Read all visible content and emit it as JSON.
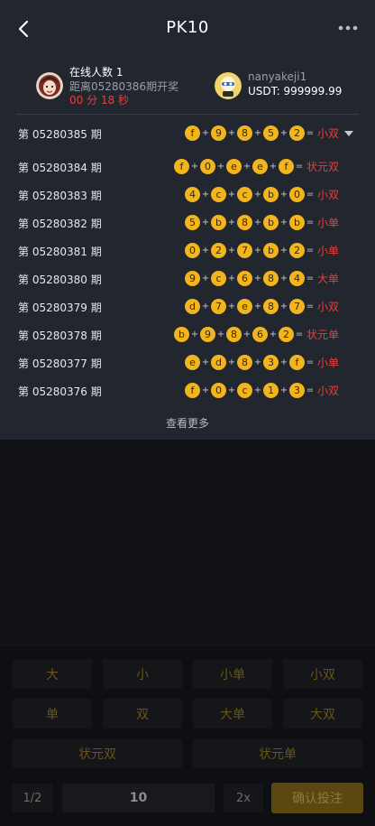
{
  "header": {
    "title": "PK10",
    "back_icon": "chevron-left-icon",
    "more_icon": "more-dots-icon"
  },
  "info": {
    "online_text": "在线人数 1",
    "countdown_label": "距离05280386期开奖",
    "countdown": "00 分 18 秒",
    "username": "nanyakeji1",
    "balance": "USDT: 999999.99"
  },
  "rows": [
    {
      "period": "第 05280385 期",
      "balls": [
        "f",
        "9",
        "8",
        "5",
        "2"
      ],
      "result": "小双",
      "expand": true
    },
    {
      "period": "第 05280384 期",
      "balls": [
        "f",
        "0",
        "e",
        "e",
        "f"
      ],
      "result": "状元双"
    },
    {
      "period": "第 05280383 期",
      "balls": [
        "4",
        "c",
        "c",
        "b",
        "0"
      ],
      "result": "小双"
    },
    {
      "period": "第 05280382 期",
      "balls": [
        "5",
        "b",
        "8",
        "b",
        "b"
      ],
      "result": "小单"
    },
    {
      "period": "第 05280381 期",
      "balls": [
        "0",
        "2",
        "7",
        "b",
        "2"
      ],
      "result": "小单"
    },
    {
      "period": "第 05280380 期",
      "balls": [
        "9",
        "c",
        "6",
        "8",
        "4"
      ],
      "result": "大单"
    },
    {
      "period": "第 05280379 期",
      "balls": [
        "d",
        "7",
        "e",
        "8",
        "7"
      ],
      "result": "小双"
    },
    {
      "period": "第 05280378 期",
      "balls": [
        "b",
        "9",
        "8",
        "6",
        "2"
      ],
      "result": "状元单"
    },
    {
      "period": "第 05280377 期",
      "balls": [
        "e",
        "d",
        "8",
        "3",
        "f"
      ],
      "result": "小单"
    },
    {
      "period": "第 05280376 期",
      "balls": [
        "f",
        "0",
        "c",
        "1",
        "3"
      ],
      "result": "小双"
    }
  ],
  "see_more": "查看更多",
  "bet_options": [
    "大",
    "小",
    "小单",
    "小双",
    "单",
    "双",
    "大单",
    "大双",
    "状元双",
    "状元单"
  ],
  "bottom": {
    "page_indicator": "1/2",
    "amount": "10",
    "multiplier": "2x",
    "confirm": "确认投注"
  },
  "colors": {
    "accent": "#f2b51d",
    "result_red": "#e8403a",
    "panel": "#22262e"
  }
}
